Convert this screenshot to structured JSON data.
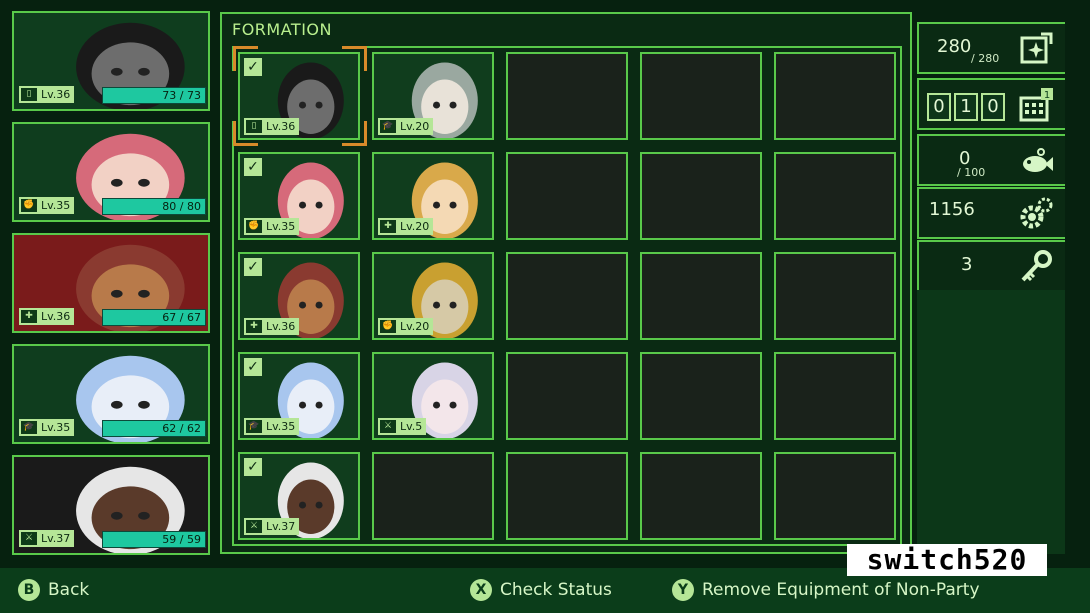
{
  "party": [
    {
      "level": "Lv.36",
      "hp": "73 / 73",
      "cls": "▯",
      "skin": "#6d6d6d",
      "hair": "#1a1a1a",
      "bg": "#0f3d1e"
    },
    {
      "level": "Lv.35",
      "hp": "80 / 80",
      "cls": "✊",
      "skin": "#f2d1c5",
      "hair": "#d66a7a",
      "bg": "#0f3d1e"
    },
    {
      "level": "Lv.36",
      "hp": "67 / 67",
      "cls": "✚",
      "skin": "#b87a4a",
      "hair": "#8a3a30",
      "bg": "#7a1b1b"
    },
    {
      "level": "Lv.35",
      "hp": "62 / 62",
      "cls": "🎓",
      "skin": "#e8eef8",
      "hair": "#a8c6ee",
      "bg": "#0f3d1e"
    },
    {
      "level": "Lv.37",
      "hp": "59 / 59",
      "cls": "⚔",
      "skin": "#5a3a2a",
      "hair": "#e6e6e6",
      "bg": "#1a1a1a"
    }
  ],
  "formation": {
    "title": "FORMATION",
    "rows": [
      [
        {
          "level": "Lv.36",
          "checked": true,
          "cls": "▯",
          "skin": "#6d6d6d",
          "hair": "#1a1a1a"
        },
        {
          "level": "Lv.20",
          "checked": false,
          "cls": "🎓",
          "skin": "#e8e2d8",
          "hair": "#9aa8a0"
        }
      ],
      [
        {
          "level": "Lv.35",
          "checked": true,
          "cls": "✊",
          "skin": "#f2d1c5",
          "hair": "#d66a7a"
        },
        {
          "level": "Lv.20",
          "checked": false,
          "cls": "✚",
          "skin": "#f4d9b4",
          "hair": "#d9a94a"
        }
      ],
      [
        {
          "level": "Lv.36",
          "checked": true,
          "cls": "✚",
          "skin": "#b87a4a",
          "hair": "#8a3a30"
        },
        {
          "level": "Lv.20",
          "checked": false,
          "cls": "✊",
          "skin": "#d6c9a6",
          "hair": "#c9a030"
        }
      ],
      [
        {
          "level": "Lv.35",
          "checked": true,
          "cls": "🎓",
          "skin": "#e8eef8",
          "hair": "#a8c6ee"
        },
        {
          "level": "Lv.5",
          "checked": false,
          "cls": "⚔",
          "skin": "#f3e6ea",
          "hair": "#d8d4e6"
        }
      ],
      [
        {
          "level": "Lv.37",
          "checked": true,
          "cls": "⚔",
          "skin": "#5a3a2a",
          "hair": "#e6e6e6"
        }
      ]
    ]
  },
  "resources": [
    {
      "value": "280",
      "max": "/ 280",
      "icon": "crystal-icon"
    },
    {
      "digits": [
        "0",
        "1",
        "0"
      ],
      "badge": "1",
      "icon": "calendar-icon"
    },
    {
      "value": "0",
      "max": "/ 100",
      "icon": "fish-icon"
    },
    {
      "value": "1156",
      "icon": "gear-icon"
    },
    {
      "value": "3",
      "icon": "key-icon"
    }
  ],
  "bottom": {
    "back": {
      "glyph": "B",
      "label": "Back"
    },
    "check": {
      "glyph": "X",
      "label": "Check Status"
    },
    "remove": {
      "glyph": "Y",
      "label": "Remove Equipment of Non-Party"
    }
  },
  "watermark": "switch520"
}
